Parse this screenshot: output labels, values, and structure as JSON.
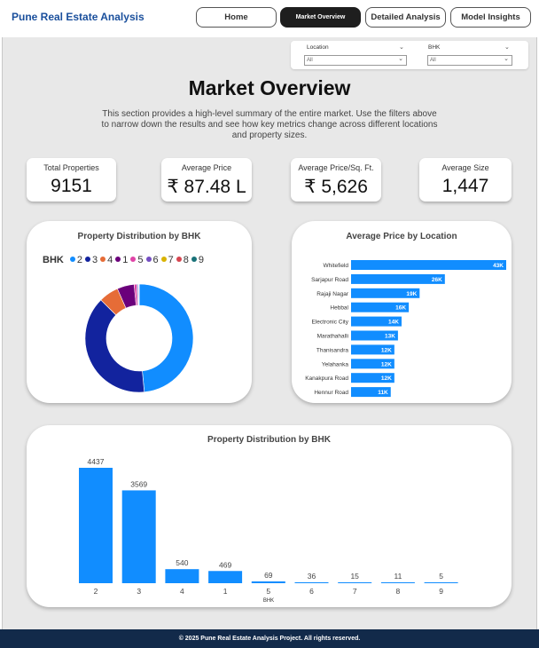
{
  "header": {
    "brand": "Pune Real Estate Analysis",
    "nav": [
      {
        "label": "Home",
        "active": false
      },
      {
        "label": "Market Overview",
        "active": true
      },
      {
        "label": "Detailed Analysis",
        "active": false
      },
      {
        "label": "Model Insights",
        "active": false
      }
    ]
  },
  "filters": {
    "location": {
      "label": "Location",
      "value": "All"
    },
    "bhk": {
      "label": "BHK",
      "value": "All"
    }
  },
  "page": {
    "title": "Market Overview",
    "description": "This section provides a high-level summary of the entire market. Use the filters above to narrow down the results and see how key metrics change across different locations and property sizes."
  },
  "kpis": [
    {
      "label": "Total Properties",
      "value": "9151"
    },
    {
      "label": "Average Price",
      "value": "₹ 87.48 L"
    },
    {
      "label": "Average Price/Sq. Ft.",
      "value": "₹ 5,626"
    },
    {
      "label": "Average Size",
      "value": "1,447"
    }
  ],
  "colors": {
    "primary": "#118dff",
    "nav_active": "#1e1e1e",
    "footer": "#122a4a",
    "brand": "#1a4f9c"
  },
  "chart_data": [
    {
      "type": "pie",
      "title": "Property Distribution by BHK",
      "legend_title": "BHK",
      "legend_position": "top-left",
      "categories": [
        "2",
        "3",
        "4",
        "1",
        "5",
        "6",
        "7",
        "8",
        "9"
      ],
      "values": [
        4437,
        3569,
        540,
        469,
        69,
        36,
        15,
        11,
        5
      ],
      "colors": [
        "#118dff",
        "#12239e",
        "#e66c37",
        "#6b007b",
        "#e044a7",
        "#744ec2",
        "#d9b300",
        "#d64550",
        "#197278"
      ]
    },
    {
      "type": "bar",
      "orientation": "horizontal",
      "title": "Average Price by Location",
      "categories": [
        "Whitefield",
        "Sarjapur Road",
        "Rajaji Nagar",
        "Hebbal",
        "Electronic City",
        "Marathahalli",
        "Thanisandra",
        "Yelahanka",
        "Kanakpura Road",
        "Hennur Road"
      ],
      "values": [
        43,
        26,
        19,
        16,
        14,
        13,
        12,
        12,
        12,
        11
      ],
      "labels": [
        "43K",
        "26K",
        "19K",
        "16K",
        "14K",
        "13K",
        "12K",
        "12K",
        "12K",
        "11K"
      ],
      "color": "#118dff"
    },
    {
      "type": "bar",
      "title": "Property Distribution by BHK",
      "xlabel": "BHK",
      "categories": [
        "2",
        "3",
        "4",
        "1",
        "5",
        "6",
        "7",
        "8",
        "9"
      ],
      "values": [
        4437,
        3569,
        540,
        469,
        69,
        36,
        15,
        11,
        5
      ],
      "color": "#118dff",
      "grid": false
    }
  ],
  "footer": {
    "text": "© 2025 Pune Real Estate Analysis Project. All rights reserved."
  }
}
